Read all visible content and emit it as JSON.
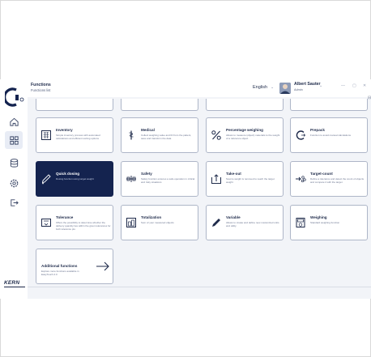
{
  "header": {
    "title": "Functions",
    "subtitle": "Functions list",
    "language": "English",
    "user_name": "Albert Sauter",
    "user_role": "Admin"
  },
  "brand": {
    "name": "KERN",
    "accent": "#14234f"
  },
  "sidebar": {
    "items": [
      {
        "icon": "home-icon"
      },
      {
        "icon": "grid-icon",
        "selected": true
      },
      {
        "icon": "database-icon"
      },
      {
        "icon": "settings-icon"
      },
      {
        "icon": "logout-icon"
      }
    ]
  },
  "functions": [
    {
      "title": "Inventory",
      "desc": "Simple inventory process with automated calculations and efficient sorting options",
      "icon": "inventory-icon",
      "active": false
    },
    {
      "title": "Medical",
      "desc": "Collect weighing value and ID from the patient, save and transform the data",
      "icon": "medical-icon",
      "active": false
    },
    {
      "title": "Percentage weighing",
      "desc": "Allows to measure (object) materials to the weight of a reference object",
      "icon": "percent-icon",
      "active": false
    },
    {
      "title": "Prepack",
      "desc": "Function to avoid manual calculations",
      "icon": "prepack-icon",
      "active": false
    },
    {
      "title": "Quick dosing",
      "desc": "Dosing function using target weight",
      "icon": "dosing-icon",
      "active": true
    },
    {
      "title": "Safety",
      "desc": "Safety function ensures a safe operation in critical and risky situations",
      "icon": "safety-icon",
      "active": false
    },
    {
      "title": "Take-out",
      "desc": "Source weight is removed to reach the target weight",
      "icon": "takeout-icon",
      "active": false
    },
    {
      "title": "Target-count",
      "desc": "Define a tolerance and detect the count of objects and compare it with the target",
      "icon": "target-count-icon",
      "active": false
    },
    {
      "title": "Tolerance",
      "desc": "Offers the possibility to determine whether the delivery quantity lies within the given tolerances for both tolerance pts",
      "icon": "tolerance-icon",
      "active": false
    },
    {
      "title": "Totalization",
      "desc": "Sum of your measured objects",
      "icon": "totalization-icon",
      "active": false
    },
    {
      "title": "Variable",
      "desc": "Allows to create and define new customized units and utility",
      "icon": "variable-icon",
      "active": false
    },
    {
      "title": "Weighing",
      "desc": "Standard weighing function",
      "icon": "weighing-icon",
      "active": false
    }
  ],
  "additional": {
    "title": "Additional functions",
    "desc": "Explore more functions available in EasyTouch 2.0"
  }
}
